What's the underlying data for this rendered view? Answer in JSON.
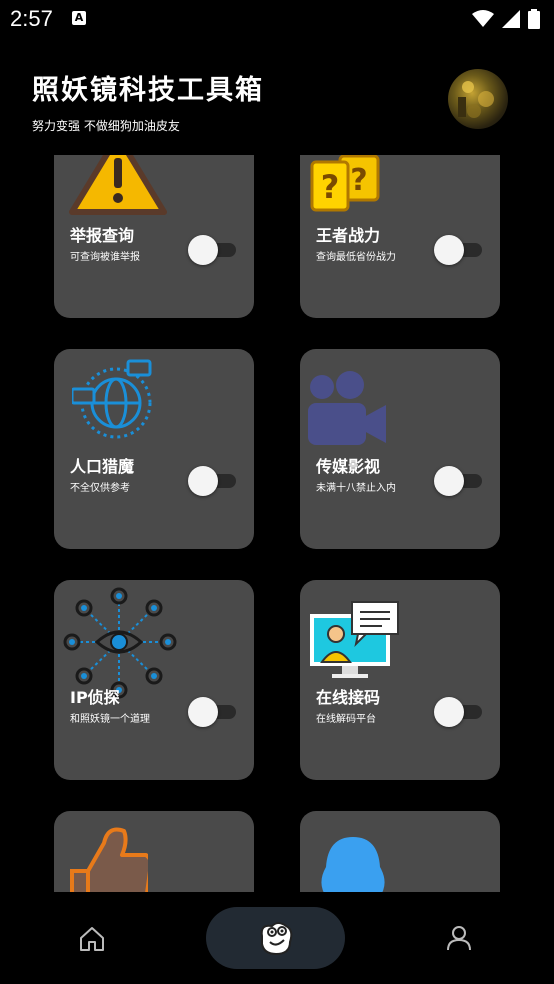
{
  "status_bar": {
    "time": "2:57",
    "notification_icon": "A"
  },
  "header": {
    "title": "照妖镜科技工具箱",
    "subtitle": "努力变强  不做细狗加油皮友"
  },
  "cards": [
    {
      "title": "举报查询",
      "desc": "可查询被谁举报",
      "icon": "warning-triangle-icon",
      "toggle_on": false
    },
    {
      "title": "王者战力",
      "desc": "查询最低省份战力",
      "icon": "question-block-icon",
      "toggle_on": false
    },
    {
      "title": "人口猎魔",
      "desc": "不全仅供参考",
      "icon": "globe-chat-icon",
      "toggle_on": false
    },
    {
      "title": "传媒影视",
      "desc": "未满十八禁止入内",
      "icon": "video-camera-icon",
      "toggle_on": false
    },
    {
      "title": "IP侦探",
      "desc": "和照妖镜一个道理",
      "icon": "eye-network-icon",
      "toggle_on": false
    },
    {
      "title": "在线接码",
      "desc": "在线解码平台",
      "icon": "monitor-chat-icon",
      "toggle_on": false
    },
    {
      "title": "",
      "desc": "",
      "icon": "thumbs-up-icon",
      "toggle_on": false
    },
    {
      "title": "",
      "desc": "",
      "icon": "qq-penguin-icon",
      "toggle_on": false
    }
  ],
  "bottom_nav": {
    "items": [
      {
        "name": "home",
        "icon": "home-icon"
      },
      {
        "name": "tools",
        "icon": "mascot-icon",
        "active": true
      },
      {
        "name": "profile",
        "icon": "user-icon"
      }
    ]
  },
  "colors": {
    "card_bg": "#4a4a4a",
    "nav_active_bg": "#222a33",
    "background": "#000000"
  }
}
